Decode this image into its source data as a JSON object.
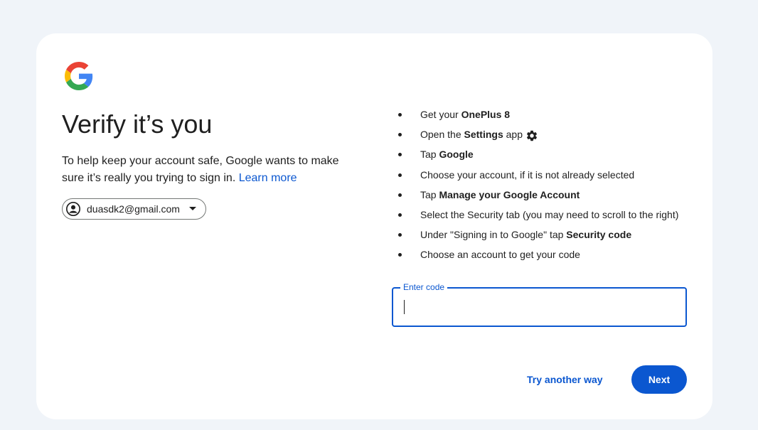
{
  "page": {
    "title": "Verify it’s you",
    "description": "To help keep your account safe, Google wants to make sure it’s really you trying to sign in.",
    "learn_more": "Learn more"
  },
  "account": {
    "email": "duasdk2@gmail.com",
    "avatar_icon": "account-circle-icon",
    "dropdown_icon": "caret-down-icon"
  },
  "steps": [
    {
      "pre": "Get your ",
      "bold": "OnePlus 8",
      "post": ""
    },
    {
      "pre": "Open the ",
      "bold": "Settings",
      "post": " app"
    },
    {
      "pre": "Tap ",
      "bold": "Google",
      "post": ""
    },
    {
      "pre": "Choose your account, if it is not already selected",
      "bold": "",
      "post": ""
    },
    {
      "pre": "Tap ",
      "bold": "Manage your Google Account",
      "post": ""
    },
    {
      "pre": "Select the Security tab (you may need to scroll to the right)",
      "bold": "",
      "post": ""
    },
    {
      "pre": "Under \"Signing in to Google\" tap ",
      "bold": "Security code",
      "post": ""
    },
    {
      "pre": "Choose an account to get your code",
      "bold": "",
      "post": ""
    }
  ],
  "code_field": {
    "label": "Enter code",
    "value": ""
  },
  "actions": {
    "try_another": "Try another way",
    "next": "Next"
  },
  "colors": {
    "accent": "#0b57d0",
    "background": "#f0f4f9",
    "card": "#ffffff"
  }
}
